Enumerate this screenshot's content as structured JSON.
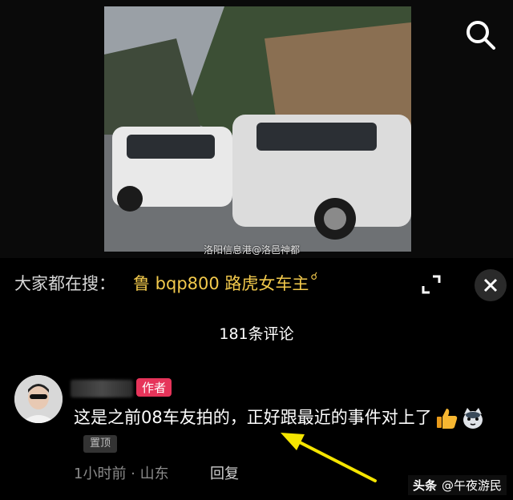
{
  "video": {
    "watermark": "洛阳信息港@洛邑神都"
  },
  "search_bar": {
    "prefix": "大家都在搜：",
    "term": "鲁 bqp800 路虎女车主",
    "term_icon": "search-icon"
  },
  "comments": {
    "count_label": "181条评论",
    "items": [
      {
        "author_tag": "作者",
        "text": "这是之前08车友拍的，正好跟最近的事件对上了",
        "emojis": [
          "thumbs-up-icon",
          "cat-face-icon"
        ],
        "pinned_label": "置顶",
        "time_location": "1小时前 · 山东",
        "reply_label": "回复"
      }
    ]
  },
  "attribution": {
    "platform": "头条",
    "account": "@午夜游民"
  },
  "colors": {
    "accent_search": "#f2c94c",
    "author_tag": "#e6345a",
    "arrow": "#f5e500"
  }
}
